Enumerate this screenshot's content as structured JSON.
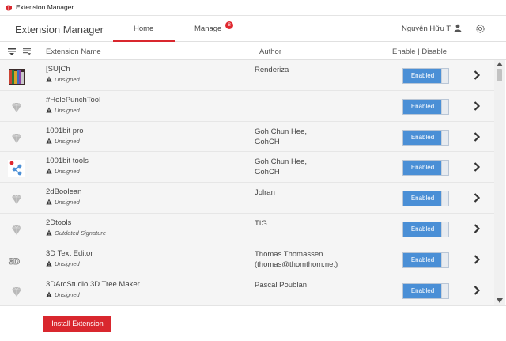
{
  "window": {
    "title": "Extension Manager"
  },
  "header": {
    "brand": "Extension Manager",
    "tabs": [
      {
        "label": "Home",
        "active": true
      },
      {
        "label": "Manage",
        "badge": "8"
      }
    ],
    "user_name": "Nguyễn Hữu T."
  },
  "columns": {
    "name": "Extension Name",
    "author": "Author",
    "enable": "Enable | Disable"
  },
  "extensions": [
    {
      "name": "[SU]Ch",
      "status": "Unsigned",
      "author_line1": "Renderiza",
      "author_line2": "",
      "toggle": "Enabled",
      "icon": "book-thumbnail-icon"
    },
    {
      "name": "#HolePunchTool",
      "status": "Unsigned",
      "author_line1": "",
      "author_line2": "",
      "toggle": "Enabled",
      "icon": "gem-icon"
    },
    {
      "name": "1001bit pro",
      "status": "Unsigned",
      "author_line1": "Goh Chun Hee,",
      "author_line2": "GohCH",
      "toggle": "Enabled",
      "icon": "gem-icon"
    },
    {
      "name": "1001bit tools",
      "status": "Unsigned",
      "author_line1": "Goh Chun Hee,",
      "author_line2": "GohCH",
      "toggle": "Enabled",
      "icon": "share-nodes-icon"
    },
    {
      "name": "2dBoolean",
      "status": "Unsigned",
      "author_line1": "Jolran",
      "author_line2": "",
      "toggle": "Enabled",
      "icon": "gem-icon"
    },
    {
      "name": "2Dtools",
      "status": "Outdated Signature",
      "author_line1": "TIG",
      "author_line2": "",
      "toggle": "Enabled",
      "icon": "gem-icon"
    },
    {
      "name": "3D Text Editor",
      "status": "Unsigned",
      "author_line1": "Thomas Thomassen",
      "author_line2": "(thomas@thomthom.net)",
      "toggle": "Enabled",
      "icon": "3d-text-icon"
    },
    {
      "name": "3DArcStudio 3D Tree Maker",
      "status": "Unsigned",
      "author_line1": "Pascal Poublan",
      "author_line2": "",
      "toggle": "Enabled",
      "icon": "gem-icon"
    }
  ],
  "footer": {
    "install_label": "Install Extension"
  },
  "colors": {
    "accent": "#d9272e",
    "toggle_on": "#4a8fd6",
    "row_bg": "#f5f5f5"
  }
}
